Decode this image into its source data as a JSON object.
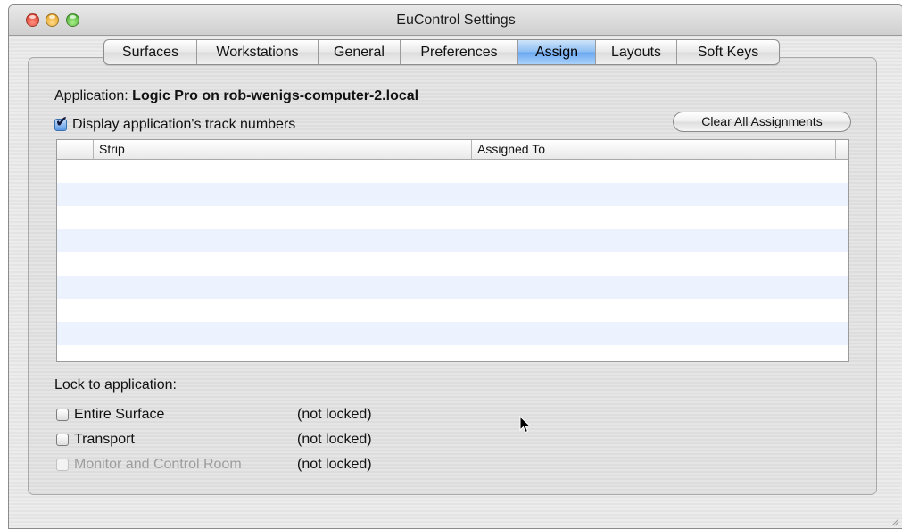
{
  "window": {
    "title": "EuControl Settings"
  },
  "tabs": [
    "Surfaces",
    "Workstations",
    "General",
    "Preferences",
    "Assign",
    "Layouts",
    "Soft Keys"
  ],
  "active_tab": "Assign",
  "assign": {
    "application_label": "Application:",
    "application_value": "Logic Pro on rob-wenigs-computer-2.local",
    "display_track_numbers": {
      "label": "Display application's track numbers",
      "checked": true
    },
    "clear_button": "Clear All Assignments",
    "table": {
      "columns": [
        "Strip",
        "Assigned To"
      ],
      "rows": []
    },
    "lock": {
      "label": "Lock to application:",
      "items": [
        {
          "label": "Entire Surface",
          "status": "(not locked)",
          "checked": false,
          "enabled": true
        },
        {
          "label": "Transport",
          "status": "(not locked)",
          "checked": false,
          "enabled": true
        },
        {
          "label": "Monitor and Control Room",
          "status": "(not locked)",
          "checked": false,
          "enabled": false
        }
      ]
    }
  },
  "colors": {
    "active_tab": "#6aa7ef",
    "table_alt_row": "#edf3fe",
    "checkbox_checked": "#5b98e6"
  }
}
